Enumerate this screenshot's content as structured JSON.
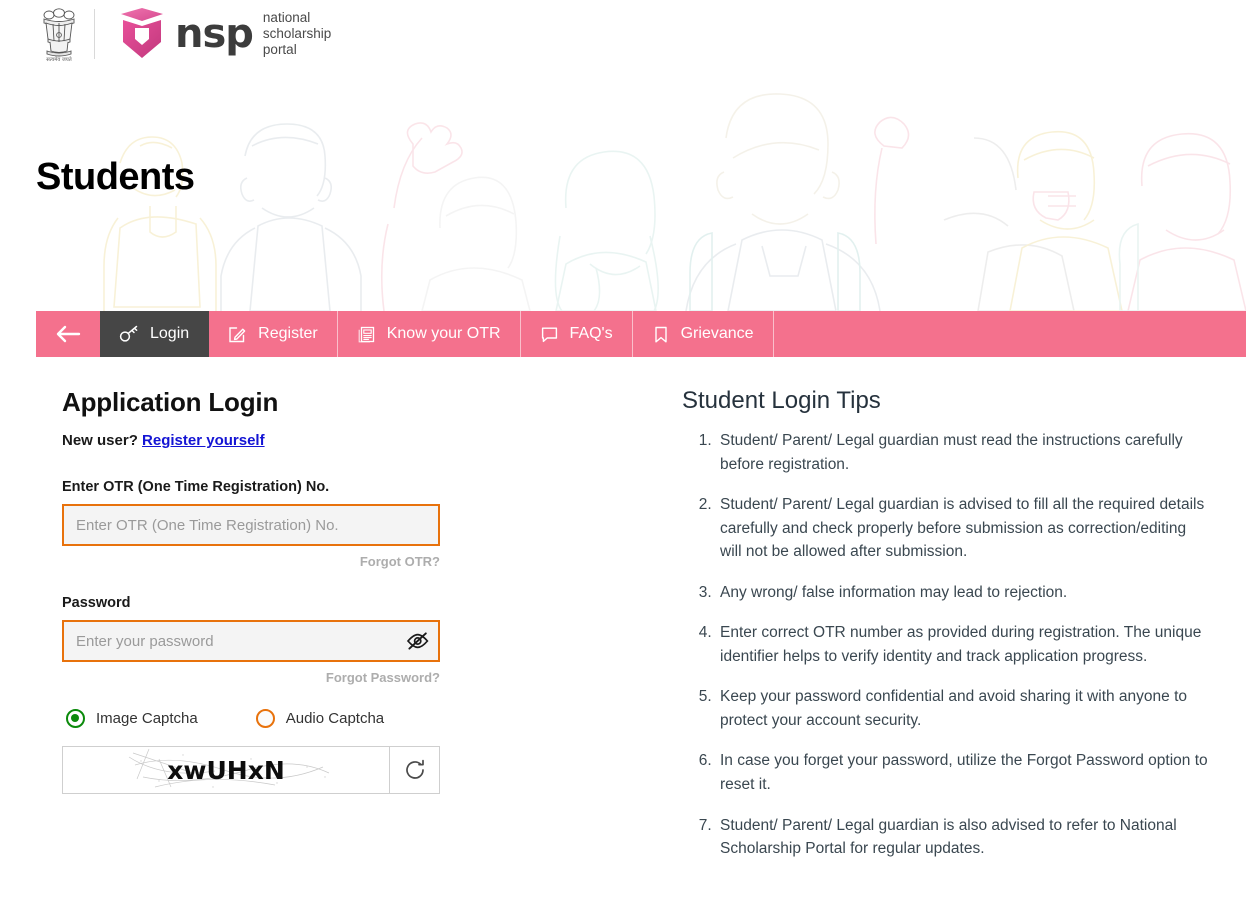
{
  "header": {
    "emblem_alt": "national-emblem-of-india",
    "emblem_caption": "सत्यमेव जयते",
    "logo_word": "nsp",
    "tagline_line1": "national",
    "tagline_line2": "scholarship",
    "tagline_line3": "portal"
  },
  "hero": {
    "title": "Students"
  },
  "nav": {
    "back_icon": "arrow-left-icon",
    "items": [
      {
        "label": "Login",
        "icon": "key-icon",
        "active": true
      },
      {
        "label": "Register",
        "icon": "pencil-square-icon",
        "active": false
      },
      {
        "label": "Know your OTR",
        "icon": "article-icon",
        "active": false
      },
      {
        "label": "FAQ's",
        "icon": "speech-bubble-icon",
        "active": false
      },
      {
        "label": "Grievance",
        "icon": "bookmark-icon",
        "active": false
      }
    ],
    "bar_color": "#f4718d",
    "active_color": "#464646"
  },
  "login": {
    "title": "Application Login",
    "new_user_text": "New user?",
    "register_link": "Register yourself",
    "otr_label": "Enter OTR (One Time Registration) No.",
    "otr_placeholder": "Enter OTR (One Time Registration) No.",
    "otr_value": "",
    "forgot_otr": "Forgot OTR?",
    "password_label": "Password",
    "password_placeholder": "Enter your password",
    "password_value": "",
    "password_toggle_icon": "eye-slash-icon",
    "forgot_password": "Forgot Password?",
    "captcha_options": [
      {
        "label": "Image Captcha",
        "selected": true,
        "color": "#0b8a0b"
      },
      {
        "label": "Audio Captcha",
        "selected": false,
        "color": "#e8720c"
      }
    ],
    "captcha_text": "xwUHxN",
    "refresh_icon": "refresh-icon",
    "input_border_color": "#e8720c",
    "link_color": "#1414d4"
  },
  "tips": {
    "title": "Student Login Tips",
    "items": [
      "Student/ Parent/ Legal guardian must read the instructions carefully before registration.",
      "Student/ Parent/ Legal guardian is advised to fill all the required details carefully and check properly before submission as correction/editing will not be allowed after submission.",
      "Any wrong/ false information may lead to rejection.",
      "Enter correct OTR number as provided during registration. The unique identifier helps to verify identity and track application progress.",
      "Keep your password confidential and avoid sharing it with anyone to protect your account security.",
      "In case you forget your password, utilize the Forgot Password option to reset it.",
      "Student/ Parent/ Legal guardian is also advised to refer to National Scholarship Portal for regular updates."
    ]
  }
}
